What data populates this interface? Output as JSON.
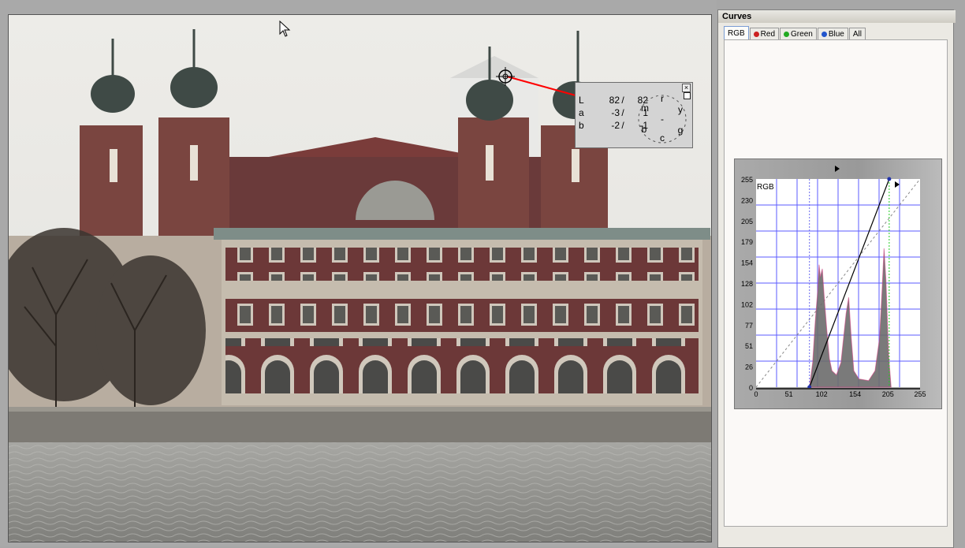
{
  "probe": {
    "close_glyph": "×",
    "rows": [
      {
        "label": "L",
        "a": "82",
        "b": "82"
      },
      {
        "label": "a",
        "a": "-3",
        "b": "1"
      },
      {
        "label": "b",
        "a": "-2",
        "b": "-1"
      }
    ],
    "wheel_labels": {
      "top": "r",
      "left_top": "m",
      "right_top": "y",
      "left_bottom": "b",
      "right_bottom": "g",
      "bottom": "c",
      "center": "-"
    }
  },
  "panel": {
    "title": "Curves",
    "tabs": [
      {
        "label": "RGB",
        "color": "",
        "active": true
      },
      {
        "label": "Red",
        "color": "#cc2222",
        "active": false
      },
      {
        "label": "Green",
        "color": "#22aa22",
        "active": false
      },
      {
        "label": "Blue",
        "color": "#2255cc",
        "active": false
      },
      {
        "label": "All",
        "color": "",
        "active": false
      }
    ]
  },
  "curves": {
    "channel_label": "RGB",
    "y_ticks": [
      "255",
      "230",
      "205",
      "179",
      "154",
      "128",
      "102",
      "77",
      "51",
      "26",
      "0"
    ],
    "x_ticks": [
      "0",
      "51",
      "102",
      "154",
      "205",
      "255"
    ],
    "curve_points": [
      [
        83,
        0
      ],
      [
        207,
        255
      ]
    ],
    "black_point": 83,
    "white_point": 207,
    "grid_color": "#5b5bff",
    "curve_color": "#000000"
  },
  "colors": {
    "sky": "#e9e8e4",
    "brick": "#6e3a3a",
    "stone": "#bdb3a6",
    "water": "#8f8f8b",
    "probe_line": "#ff0000"
  }
}
